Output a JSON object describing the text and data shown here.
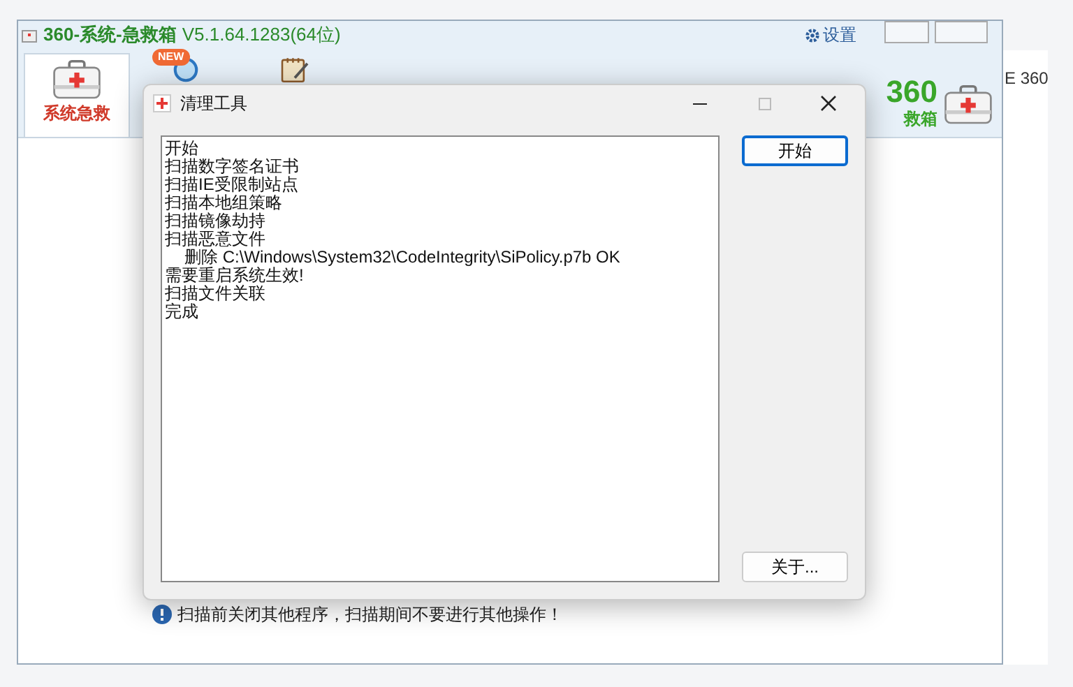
{
  "app_window": {
    "title": "360-系统-急救箱",
    "version": "V5.1.64.1283(64位)",
    "settings": "设置",
    "tools": [
      {
        "kind": "medkit",
        "label": "系统急救",
        "selected": true
      },
      {
        "kind": "search",
        "badge": "NEW",
        "selected": false
      },
      {
        "kind": "notepad",
        "selected": false
      }
    ],
    "logo": {
      "number": "360",
      "text": "救箱"
    },
    "notice": "扫描前关闭其他程序，扫描期间不要进行其他操作！"
  },
  "other_window": {
    "text": "E 360"
  },
  "dialog": {
    "title": "清理工具",
    "log": [
      {
        "text": "开始"
      },
      {
        "text": "扫描数字签名证书"
      },
      {
        "text": "扫描IE受限制站点"
      },
      {
        "text": "扫描本地组策略"
      },
      {
        "text": "扫描镜像劫持"
      },
      {
        "text": "扫描恶意文件",
        "children": [
          {
            "text": "删除 C:\\Windows\\System32\\CodeIntegrity\\SiPolicy.p7b OK"
          }
        ]
      },
      {
        "text": "需要重启系统生效!"
      },
      {
        "text": "扫描文件关联"
      },
      {
        "text": "完成"
      }
    ],
    "buttons": [
      "开始",
      "关于..."
    ]
  }
}
